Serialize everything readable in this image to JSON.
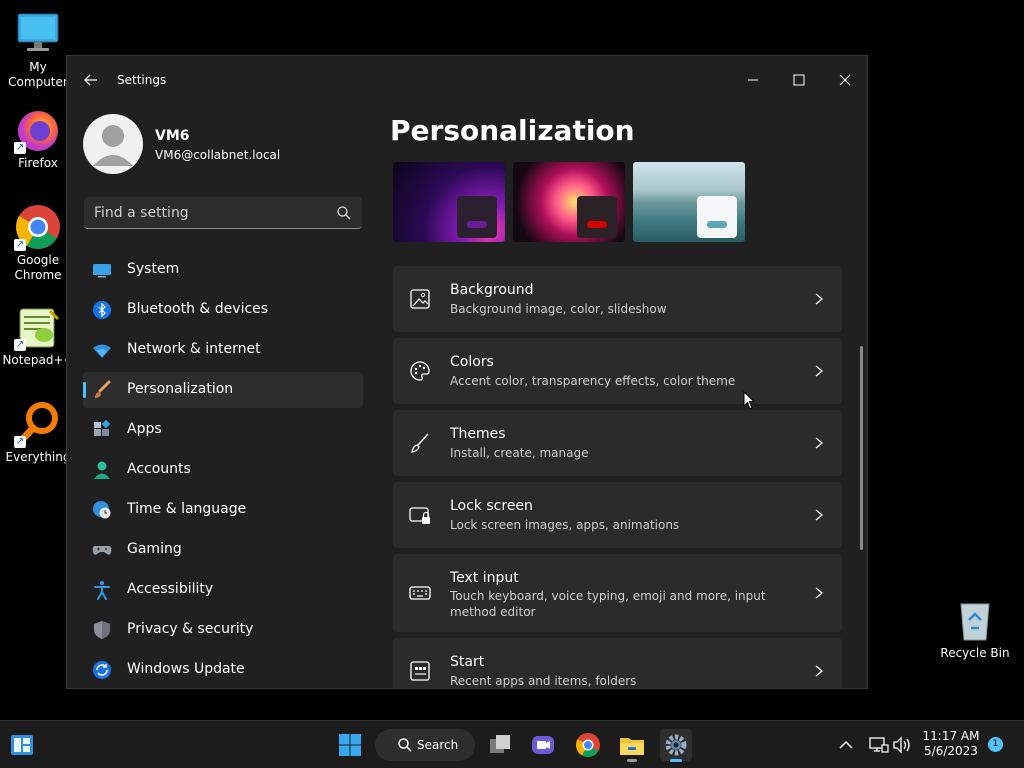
{
  "desktop": {
    "icons": [
      {
        "label": "My Computer"
      },
      {
        "label": "Firefox"
      },
      {
        "label": "Google Chrome"
      },
      {
        "label": "Notepad++"
      },
      {
        "label": "Everything"
      },
      {
        "label": "Recycle Bin"
      }
    ]
  },
  "window": {
    "title": "Settings",
    "profile": {
      "name": "VM6",
      "email": "VM6@collabnet.local"
    },
    "search": {
      "placeholder": "Find a setting"
    },
    "nav": [
      {
        "label": "System",
        "icon": "monitor-icon"
      },
      {
        "label": "Bluetooth & devices",
        "icon": "bluetooth-icon"
      },
      {
        "label": "Network & internet",
        "icon": "wifi-icon"
      },
      {
        "label": "Personalization",
        "icon": "paintbrush-icon",
        "active": true
      },
      {
        "label": "Apps",
        "icon": "apps-icon"
      },
      {
        "label": "Accounts",
        "icon": "person-icon"
      },
      {
        "label": "Time & language",
        "icon": "globe-clock-icon"
      },
      {
        "label": "Gaming",
        "icon": "gamepad-icon"
      },
      {
        "label": "Accessibility",
        "icon": "accessibility-icon"
      },
      {
        "label": "Privacy & security",
        "icon": "shield-icon"
      },
      {
        "label": "Windows Update",
        "icon": "update-icon"
      }
    ],
    "page_title": "Personalization",
    "themes": [
      {
        "name": "purple-glow",
        "accent": "#6a1b9a"
      },
      {
        "name": "flower",
        "accent": "#d50000"
      },
      {
        "name": "lake",
        "accent": "#5aa6b5"
      }
    ],
    "cards": [
      {
        "title": "Background",
        "subtitle": "Background image, color, slideshow",
        "icon": "image-icon"
      },
      {
        "title": "Colors",
        "subtitle": "Accent color, transparency effects, color theme",
        "icon": "palette-icon"
      },
      {
        "title": "Themes",
        "subtitle": "Install, create, manage",
        "icon": "brush-icon"
      },
      {
        "title": "Lock screen",
        "subtitle": "Lock screen images, apps, animations",
        "icon": "lock-screen-icon"
      },
      {
        "title": "Text input",
        "subtitle": "Touch keyboard, voice typing, emoji and more, input method editor",
        "icon": "keyboard-icon"
      },
      {
        "title": "Start",
        "subtitle": "Recent apps and items, folders",
        "icon": "start-icon"
      }
    ]
  },
  "taskbar": {
    "search_label": "Search",
    "time": "11:17 AM",
    "date": "5/6/2023",
    "notification_count": "1"
  },
  "colors": {
    "accent": "#4cc2ff",
    "window_bg": "#202020",
    "card_bg": "#2b2b2b"
  }
}
